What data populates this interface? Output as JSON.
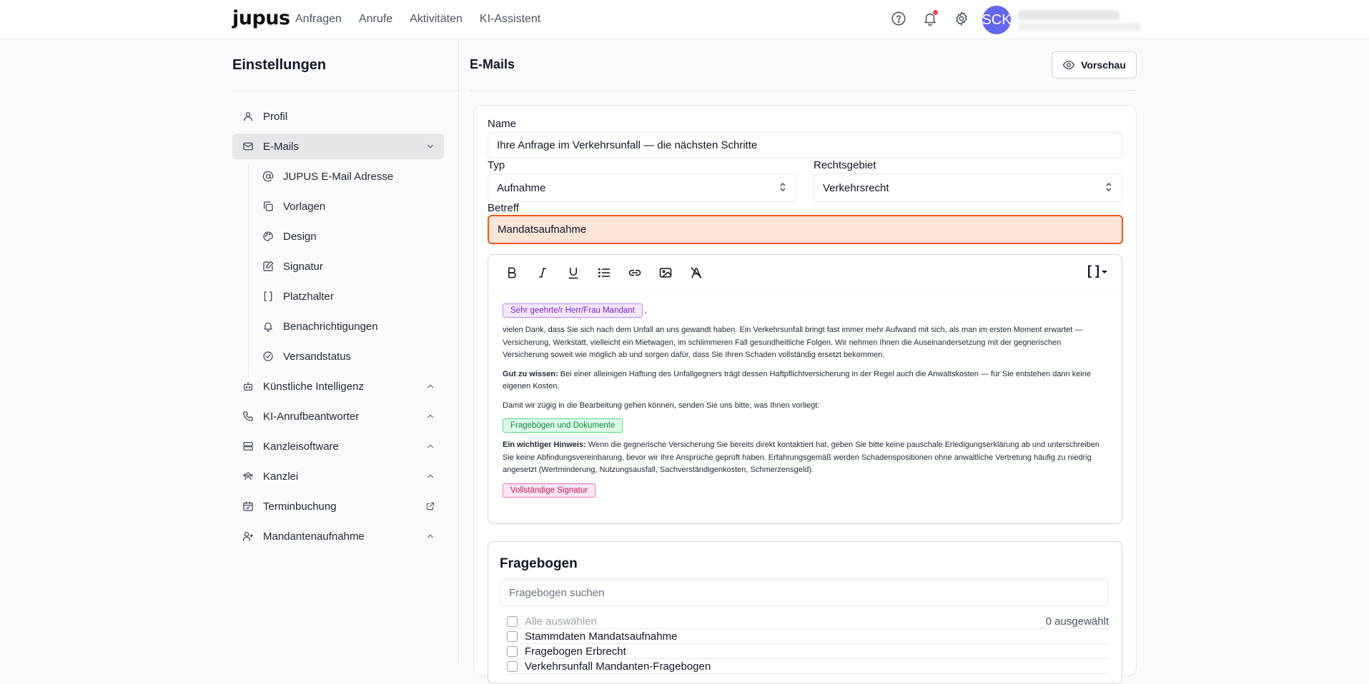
{
  "app": {
    "logo": "jupus",
    "nav": [
      "Anfragen",
      "Anrufe",
      "Aktivitäten",
      "KI-Assistent"
    ],
    "avatar_initials": "SCK",
    "notification_dot_color": "#ef4444",
    "avatar_color": "#6366f1"
  },
  "sidebar": {
    "title": "Einstellungen",
    "items": [
      {
        "label": "Profil",
        "icon": "user-icon"
      },
      {
        "label": "E-Mails",
        "icon": "mail-icon",
        "active": true,
        "expanded": true
      },
      {
        "label": "JUPUS E-Mail Adresse",
        "icon": "at-icon",
        "sub": true
      },
      {
        "label": "Vorlagen",
        "icon": "copy-icon",
        "sub": true
      },
      {
        "label": "Design",
        "icon": "palette-icon",
        "sub": true
      },
      {
        "label": "Signatur",
        "icon": "signature-icon",
        "sub": true
      },
      {
        "label": "Platzhalter",
        "icon": "brackets-icon",
        "sub": true
      },
      {
        "label": "Benachrichtigungen",
        "icon": "bell-icon",
        "sub": true
      },
      {
        "label": "Versandstatus",
        "icon": "check-circle-icon",
        "sub": true
      },
      {
        "label": "Künstliche Intelligenz",
        "icon": "bot-icon"
      },
      {
        "label": "KI-Anrufbeantworter",
        "icon": "phone-icon"
      },
      {
        "label": "Kanzleisoftware",
        "icon": "server-icon"
      },
      {
        "label": "Kanzlei",
        "icon": "team-icon"
      },
      {
        "label": "Terminbuchung",
        "icon": "calendar-icon"
      },
      {
        "label": "Mandantenaufnahme",
        "icon": "user-plus-icon"
      }
    ]
  },
  "main": {
    "title": "E-Mails",
    "preview_label": "Vorschau",
    "form": {
      "name_label": "Name",
      "name_value": "Ihre Anfrage im Verkehrsunfall — die nächsten Schritte",
      "type_label": "Typ",
      "type_value": "Aufnahme",
      "area_label": "Rechtsgebiet",
      "area_value": "Verkehrsrecht",
      "subject_label": "Betreff",
      "subject_value": "Mandatsaufnahme",
      "error_color": "#ea580c"
    },
    "editor": {
      "placeholder_button": "[ ]",
      "chip_salutation": "Sehr geehrte/r Herr/Frau Mandant",
      "salutation_suffix": ",",
      "p1": "vielen Dank, dass Sie sich nach dem Unfall an uns gewandt haben. Ein Verkehrsunfall bringt fast immer mehr Aufwand mit sich, als man im ersten Moment erwartet — Versicherung, Werkstatt, vielleicht ein Mietwagen, im schlimmeren Fall gesundheitliche Folgen. Wir nehmen Ihnen die Auseinandersetzung mit der gegnerischen Versicherung soweit wie möglich ab und sorgen dafür, dass Sie Ihren Schaden vollständig ersetzt bekommen.",
      "p2_bold": "Gut zu wissen:",
      "p2": " Bei einer alleinigen Haftung des Unfallgegners trägt dessen Haftpflichtversicherung in der Regel auch die Anwaltskosten — für Sie entstehen dann keine eigenen Kosten.",
      "p3": "Damit wir zügig in die Bearbeitung gehen können, senden Sie uns bitte, was Ihnen vorliegt:",
      "chip_documents": "Fragebögen und Dokumente",
      "p4_bold": "Ein wichtiger Hinweis:",
      "p4": " Wenn die gegnerische Versicherung Sie bereits direkt kontaktiert hat, geben Sie bitte keine pauschale Erledigungserklärung ab und unterschreiben Sie keine Abfindungsvereinbarung, bevor wir Ihre Ansprüche geprüft haben. Erfahrungsgemäß werden Schadenspositionen ohne anwaltliche Vertretung häufig zu niedrig angesetzt (Wertminderung, Nutzungsausfall, Sachverständigenkosten, Schmerzensgeld).",
      "chip_signature": "Vollständige Signatur"
    },
    "questionnaire": {
      "title": "Fragebogen",
      "search_placeholder": "Fragebogen suchen",
      "select_all": "Alle auswählen",
      "selected_count": "0 ausgewählt",
      "items": [
        "Stammdaten Mandatsaufnahme",
        "Fragebogen Erbrecht",
        "Verkehrsunfall Mandanten-Fragebogen"
      ]
    }
  }
}
